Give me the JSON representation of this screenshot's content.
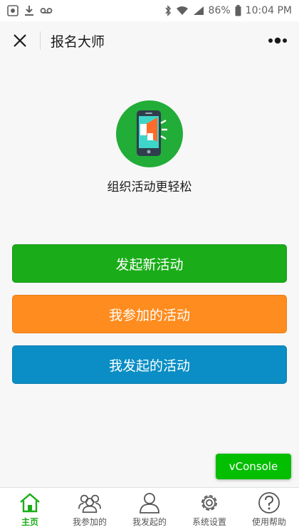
{
  "statusbar": {
    "battery": "86%",
    "time": "10:04 PM",
    "icons": [
      "photo-icon",
      "download-icon",
      "voicemail-icon",
      "bluetooth-icon",
      "wifi-icon",
      "signal-icon",
      "battery-icon"
    ]
  },
  "navbar": {
    "title": "报名大师",
    "close_icon": "close-icon",
    "more_icon": "more-icon"
  },
  "hero": {
    "icon": "megaphone-phone-icon",
    "slogan": "组织活动更轻松"
  },
  "buttons": {
    "new_activity": "发起新活动",
    "joined_activities": "我参加的活动",
    "my_activities": "我发起的活动"
  },
  "vconsole": {
    "label": "vConsole"
  },
  "tabs": [
    {
      "label": "主页",
      "icon": "home-icon",
      "active": true
    },
    {
      "label": "我参加的",
      "icon": "group-icon",
      "active": false
    },
    {
      "label": "我发起的",
      "icon": "user-icon",
      "active": false
    },
    {
      "label": "系统设置",
      "icon": "gear-icon",
      "active": false
    },
    {
      "label": "使用帮助",
      "icon": "help-icon",
      "active": false
    }
  ],
  "colors": {
    "green": "#1aad19",
    "orange": "#ff8c1e",
    "blue": "#0a8ec5",
    "vconsole": "#04be02"
  }
}
